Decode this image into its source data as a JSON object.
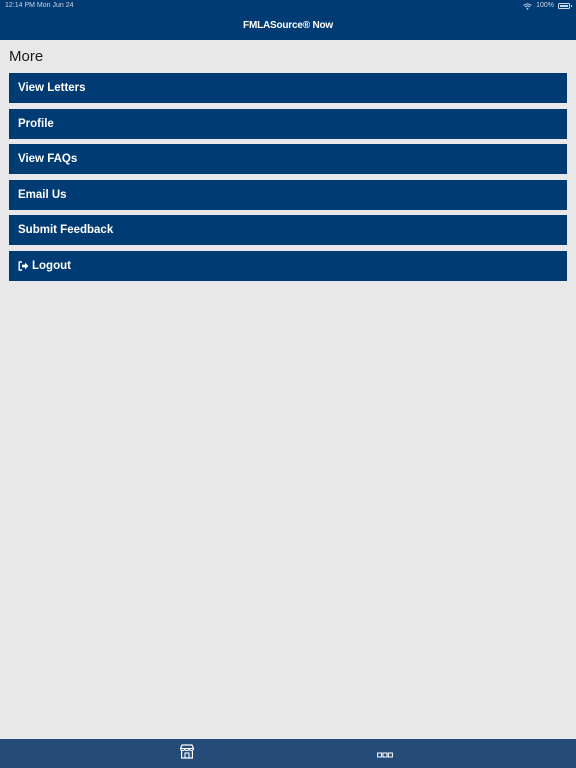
{
  "status_bar": {
    "time_date": "12:14 PM  Mon Jun 24",
    "battery": "100%"
  },
  "app": {
    "title": "FMLASource® Now"
  },
  "page": {
    "section_title": "More"
  },
  "menu": {
    "items": [
      {
        "label": "View Letters",
        "icon": ""
      },
      {
        "label": "Profile",
        "icon": ""
      },
      {
        "label": "View FAQs",
        "icon": ""
      },
      {
        "label": "Email Us",
        "icon": ""
      },
      {
        "label": "Submit Feedback",
        "icon": ""
      },
      {
        "label": "Logout",
        "icon": "logout-icon"
      }
    ]
  },
  "tabbar": {
    "tabs": [
      {
        "icon": "store-icon"
      },
      {
        "icon": "more-dots-icon"
      }
    ]
  },
  "colors": {
    "brand_navy": "#003b73",
    "tabbar": "#254c78",
    "background": "#e8e8e8"
  }
}
